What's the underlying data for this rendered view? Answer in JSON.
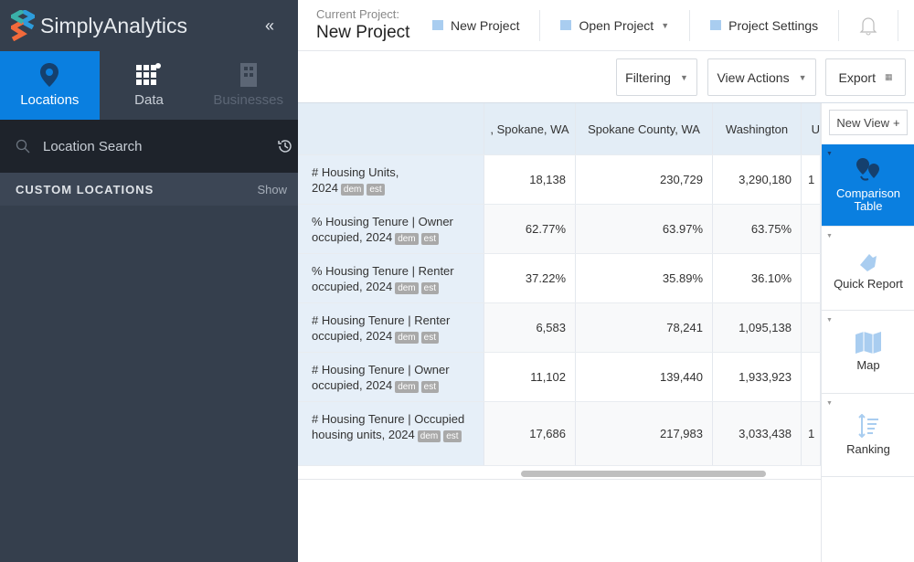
{
  "app": {
    "name": "SimplyAnalytics",
    "collapse_icon": "double-chevron-left"
  },
  "sidebar": {
    "tabs": [
      {
        "label": "Locations",
        "icon": "map-pin"
      },
      {
        "label": "Data",
        "icon": "grid"
      },
      {
        "label": "Businesses",
        "icon": "building"
      }
    ],
    "search_placeholder": "Location Search",
    "custom_locations": "CUSTOM LOCATIONS",
    "show": "Show"
  },
  "header": {
    "current_project_label": "Current Project:",
    "current_project": "New Project",
    "new_project": "New Project",
    "open_project": "Open Project",
    "project_settings": "Project Settings"
  },
  "toolbar": {
    "filtering": "Filtering",
    "view_actions": "View Actions",
    "export": "Export"
  },
  "table": {
    "columns": [
      ", Spokane, WA",
      "Spokane County, WA",
      "Washington",
      "U"
    ],
    "rows": [
      {
        "label": "# Housing Units, 2024",
        "values": [
          "18,138",
          "230,729",
          "3,290,180",
          "1"
        ]
      },
      {
        "label": "% Housing Tenure | Owner occupied, 2024",
        "values": [
          "62.77%",
          "63.97%",
          "63.75%",
          ""
        ]
      },
      {
        "label": "% Housing Tenure | Renter occupied, 2024",
        "values": [
          "37.22%",
          "35.89%",
          "36.10%",
          ""
        ]
      },
      {
        "label": "# Housing Tenure | Renter occupied, 2024",
        "values": [
          "6,583",
          "78,241",
          "1,095,138",
          ""
        ]
      },
      {
        "label": "# Housing Tenure | Owner occupied, 2024",
        "values": [
          "11,102",
          "139,440",
          "1,933,923",
          ""
        ]
      },
      {
        "label": "# Housing Tenure | Occupied housing units, 2024",
        "values": [
          "17,686",
          "217,983",
          "3,033,438",
          "1"
        ]
      }
    ],
    "badges": [
      "dem",
      "est"
    ]
  },
  "views": {
    "new_view": "New View",
    "items": [
      {
        "label": "Comparison Table",
        "active": true
      },
      {
        "label": "Quick Report"
      },
      {
        "label": "Map"
      },
      {
        "label": "Ranking"
      }
    ]
  },
  "colors": {
    "accent": "#0a7fe0",
    "sidebar": "#353f4d"
  }
}
